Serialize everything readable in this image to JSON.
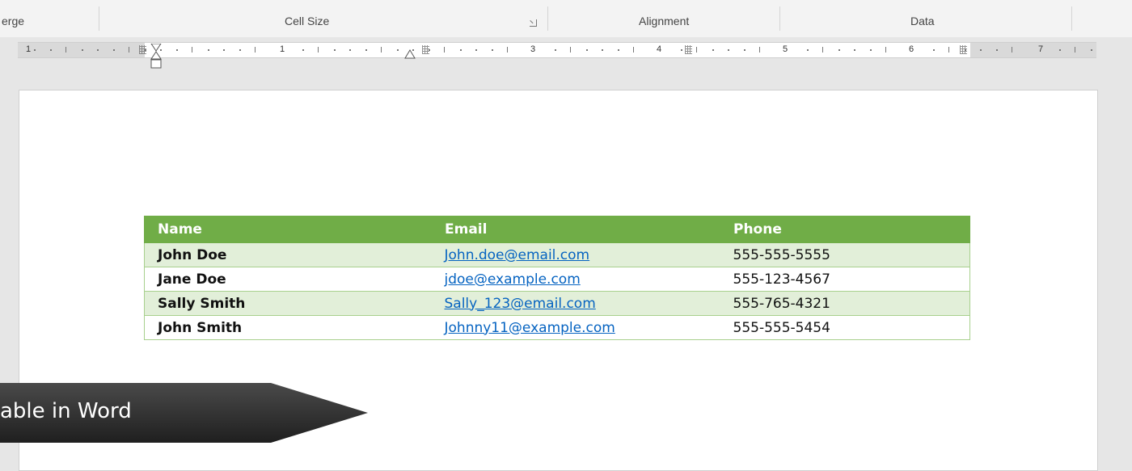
{
  "ribbon": {
    "groups": [
      {
        "label": "erge"
      },
      {
        "label": "Cell Size"
      },
      {
        "label": "Alignment"
      },
      {
        "label": "Data"
      }
    ]
  },
  "ruler": {
    "numbers": [
      "1",
      "1",
      "3",
      "4",
      "5",
      "6",
      "7"
    ]
  },
  "table": {
    "headers": [
      "Name",
      "Email",
      "Phone"
    ],
    "rows": [
      {
        "name": "John Doe",
        "email": "John.doe@email.com",
        "phone": "555-555-5555"
      },
      {
        "name": "Jane Doe",
        "email": "jdoe@example.com",
        "phone": "555-123-4567"
      },
      {
        "name": "Sally Smith",
        "email": "Sally_123@email.com",
        "phone": "555-765-4321"
      },
      {
        "name": "John Smith",
        "email": "Johnny11@example.com",
        "phone": "555-555-5454"
      }
    ],
    "colors": {
      "header_bg": "#70ad47",
      "band_bg": "#e2efd9",
      "border": "#a8d08d",
      "link": "#0563c1"
    }
  },
  "callout": {
    "text": "able in Word",
    "color": "#333333"
  },
  "icons": {
    "dialog_launcher": "dialog-launcher-icon",
    "indent_marker": "indent-marker-icon",
    "column_marker": "table-column-marker-icon"
  }
}
